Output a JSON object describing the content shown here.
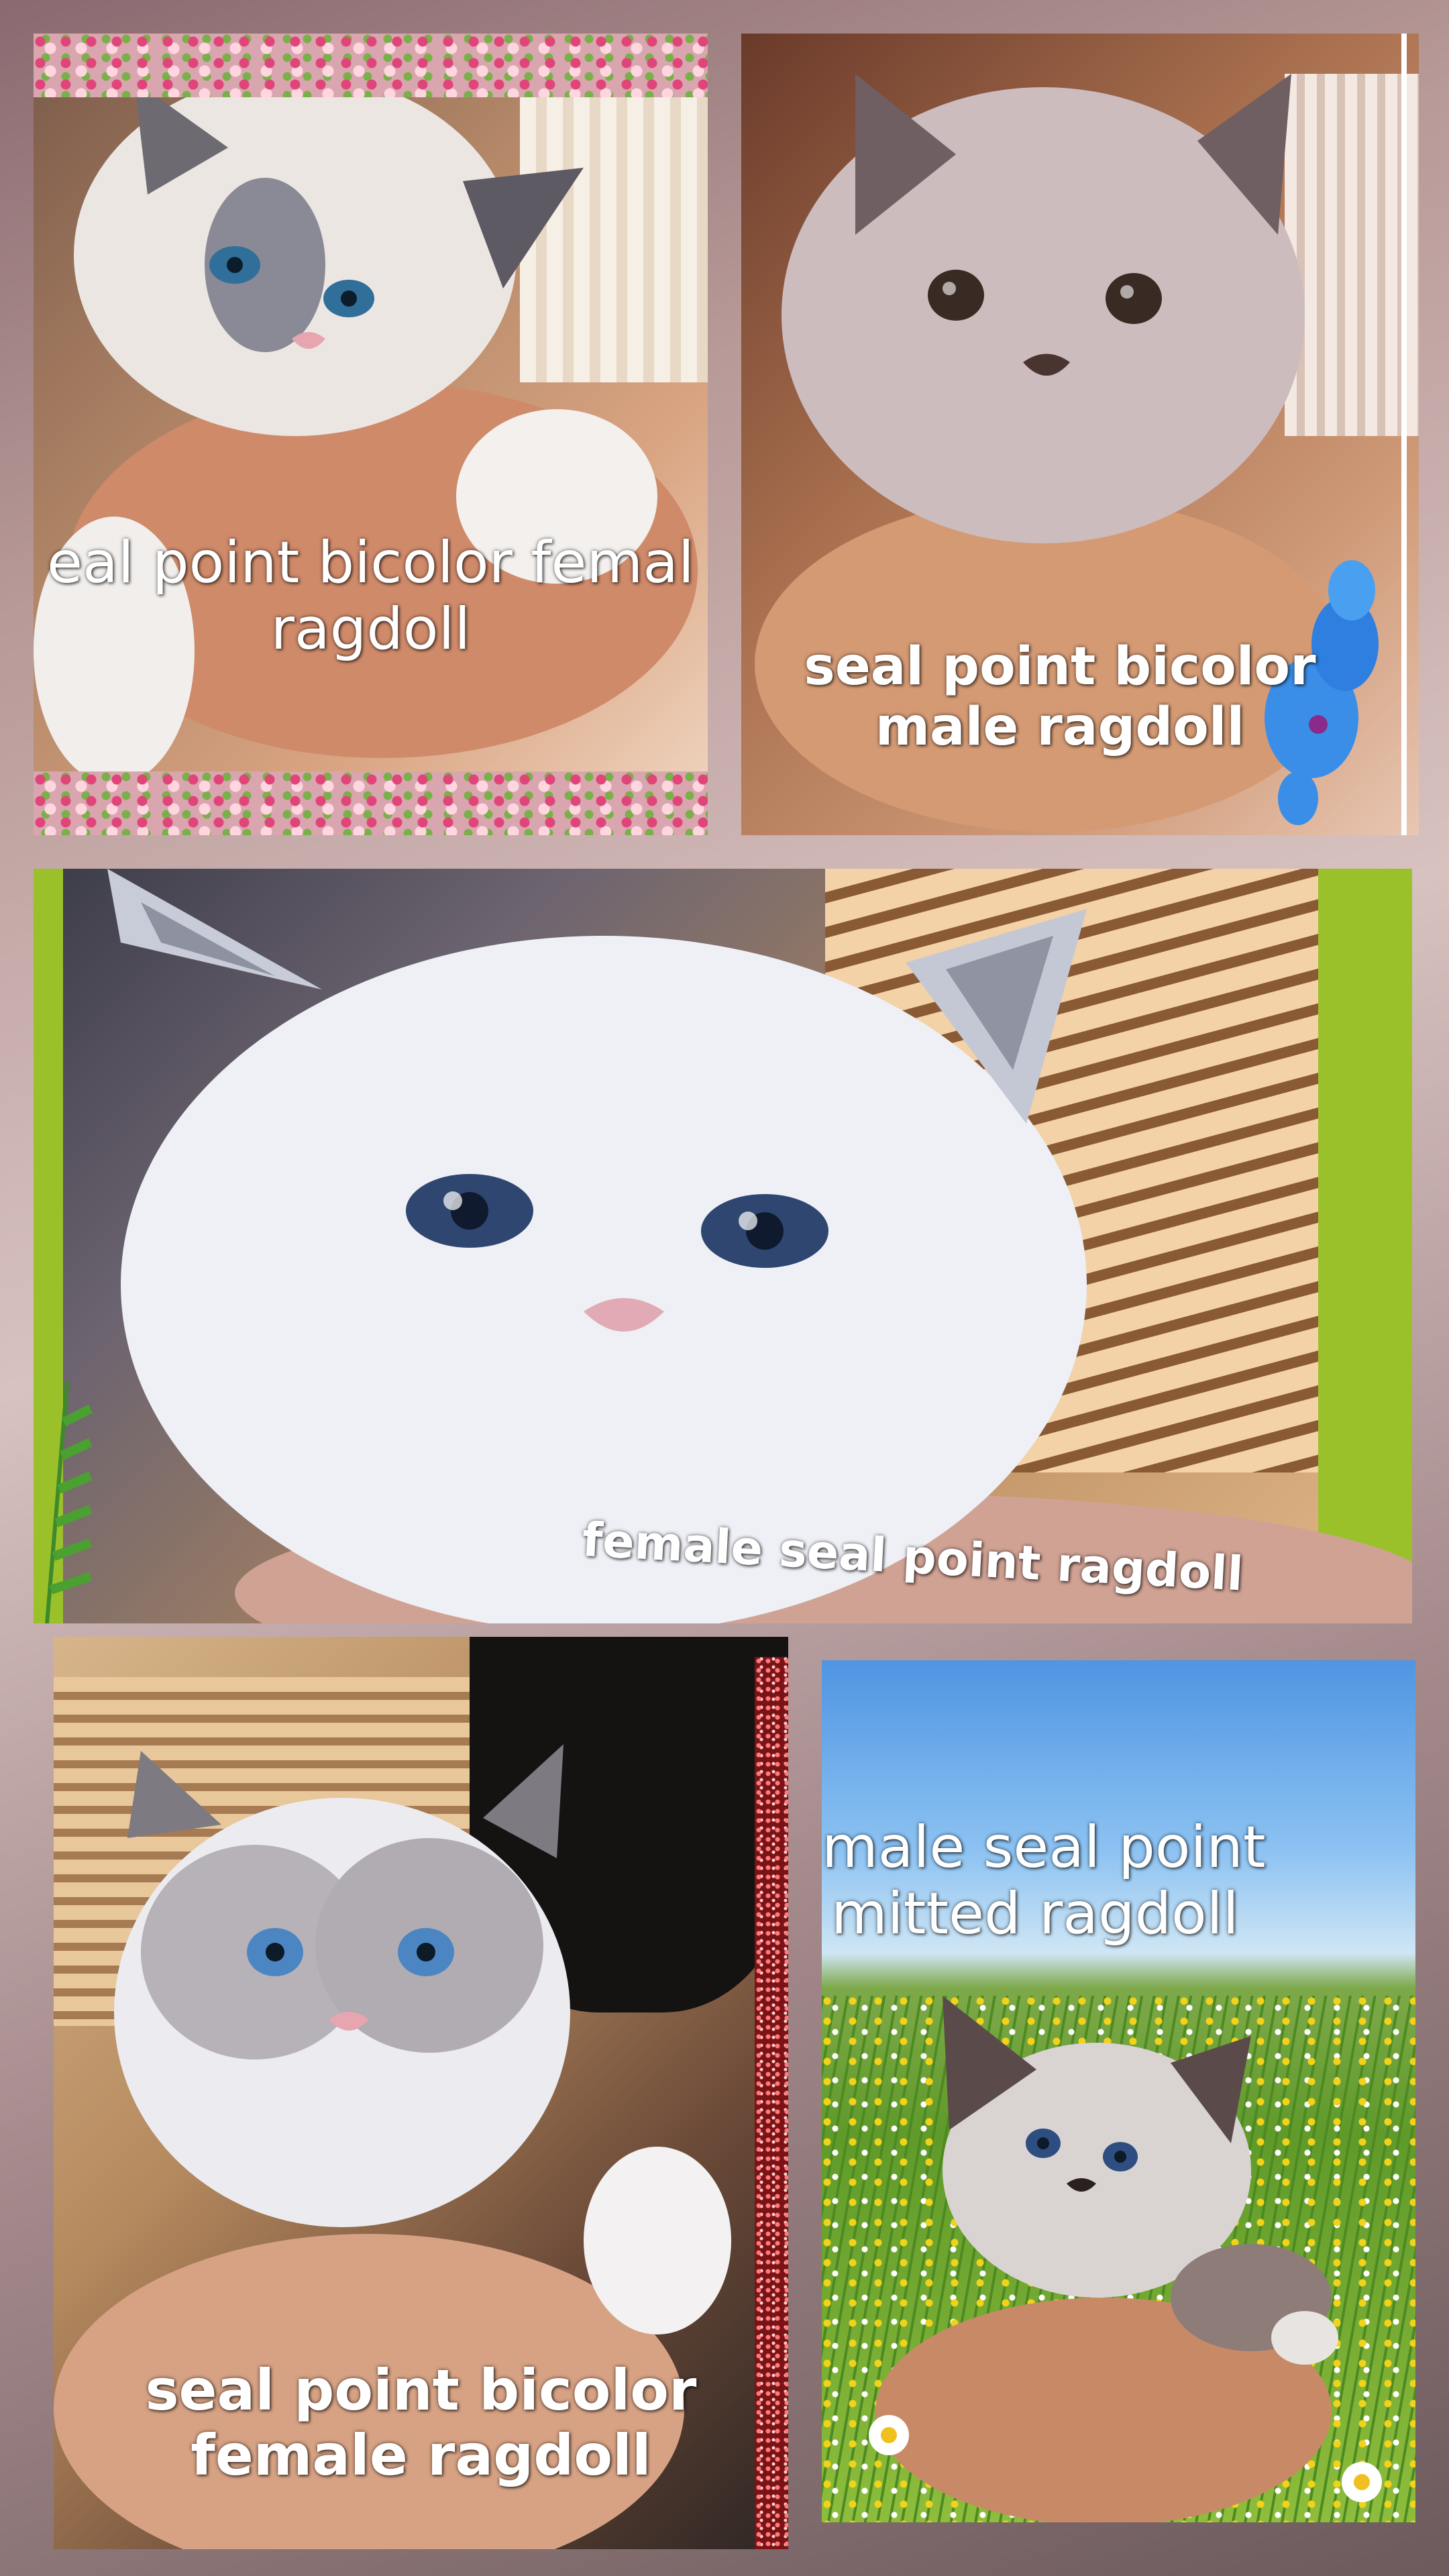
{
  "panels": [
    {
      "caption_lines": [
        "eal point bicolor femal",
        "ragdoll"
      ]
    },
    {
      "caption_lines": [
        "seal point bicolor",
        "male  ragdoll"
      ]
    },
    {
      "caption_lines": [
        "female seal point ragdoll"
      ]
    },
    {
      "caption_lines": [
        "seal point bicolor",
        "female  ragdoll"
      ]
    },
    {
      "caption_lines": [
        "male seal point",
        "mitted ragdoll"
      ]
    }
  ],
  "colors": {
    "accent_green": "#9bc12a",
    "orchid_blue": "#3a8ee8",
    "sky_blue": "#6cb4ef",
    "grass_green": "#5f9a2a"
  }
}
